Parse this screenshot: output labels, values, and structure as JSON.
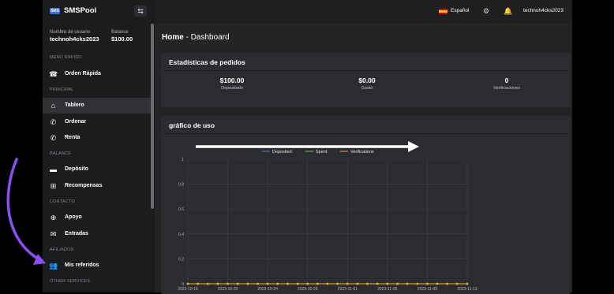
{
  "brand": {
    "badge": "SMS",
    "name": "SMSPool"
  },
  "account": {
    "user_label": "Nombre de usuario",
    "user_value": "technoh4cks2023",
    "balance_label": "Balance",
    "balance_value": "$100.00"
  },
  "sidebar": {
    "sections": [
      "MENÚ RÁPIDO",
      "PRINCIPAL",
      "BALANCE",
      "CONTACTO",
      "AFILIADOS",
      "OTHER SERVICES"
    ],
    "items": [
      {
        "label": "Orden Rápida",
        "icon": "phone-icon"
      },
      {
        "label": "Tablero",
        "icon": "home-icon"
      },
      {
        "label": "Ordenar",
        "icon": "phone-incoming-icon"
      },
      {
        "label": "Renta",
        "icon": "phone-call-icon"
      },
      {
        "label": "Depósito",
        "icon": "credit-card-icon"
      },
      {
        "label": "Recompensas",
        "icon": "gift-icon"
      },
      {
        "label": "Apoyo",
        "icon": "lifebuoy-icon"
      },
      {
        "label": "Entradas",
        "icon": "envelope-icon"
      },
      {
        "label": "Mis referidos",
        "icon": "users-icon"
      }
    ]
  },
  "topbar": {
    "language": "Español",
    "username": "technoh4cks2023"
  },
  "page": {
    "breadcrumb_home": "Home",
    "breadcrumb_sep": " - ",
    "title": "Dashboard"
  },
  "stats": {
    "title": "Estadísticas de pedidos",
    "items": [
      {
        "value": "$100.00",
        "label": "Depositado"
      },
      {
        "value": "$0.00",
        "label": "Gastó"
      },
      {
        "value": "0",
        "label": "Verificaciones"
      }
    ]
  },
  "usage": {
    "title": "gráfico de uso"
  },
  "colors": {
    "accent": "#3b6fd8",
    "deposited": "#5b7fd6",
    "spent": "#8bc34a",
    "verifications": "#f0b429",
    "arrow": "#8a4ff0"
  },
  "chart_data": {
    "type": "line",
    "x": [
      "2023-10-16",
      "2023-10-17",
      "2023-10-18",
      "2023-10-19",
      "2023-10-20",
      "2023-10-21",
      "2023-10-22",
      "2023-10-23",
      "2023-10-24",
      "2023-10-25",
      "2023-10-26",
      "2023-10-27",
      "2023-10-28",
      "2023-10-29",
      "2023-10-30",
      "2023-10-31",
      "2023-11-01",
      "2023-11-02",
      "2023-11-03",
      "2023-11-04",
      "2023-11-05",
      "2023-11-06",
      "2023-11-07",
      "2023-11-08",
      "2023-11-09",
      "2023-11-10",
      "2023-11-11",
      "2023-11-12",
      "2023-11-13"
    ],
    "tick_labels": [
      "2023-10-16",
      "2023-10-20",
      "2023-10-24",
      "2023-10-28",
      "2023-11-01",
      "2023-11-05",
      "2023-11-09",
      "2023-11-13"
    ],
    "y_ticks": [
      "0",
      "0.2",
      "0.4",
      "0.6",
      "0.8",
      "1"
    ],
    "ylim": [
      0,
      1
    ],
    "grid": true,
    "legend": "top",
    "series": [
      {
        "name": "Deposited",
        "values": [
          0,
          0,
          0,
          0,
          0,
          0,
          0,
          0,
          0,
          0,
          0,
          0,
          0,
          0,
          0,
          0,
          0,
          0,
          0,
          0,
          0,
          0,
          0,
          0,
          0,
          0,
          0,
          0,
          0
        ]
      },
      {
        "name": "Spent",
        "values": [
          0,
          0,
          0,
          0,
          0,
          0,
          0,
          0,
          0,
          0,
          0,
          0,
          0,
          0,
          0,
          0,
          0,
          0,
          0,
          0,
          0,
          0,
          0,
          0,
          0,
          0,
          0,
          0,
          0
        ]
      },
      {
        "name": "Verifications",
        "values": [
          0,
          0,
          0,
          0,
          0,
          0,
          0,
          0,
          0,
          0,
          0,
          0,
          0,
          0,
          0,
          0,
          0,
          0,
          0,
          0,
          0,
          0,
          0,
          0,
          0,
          0,
          0,
          0,
          0
        ]
      }
    ]
  }
}
